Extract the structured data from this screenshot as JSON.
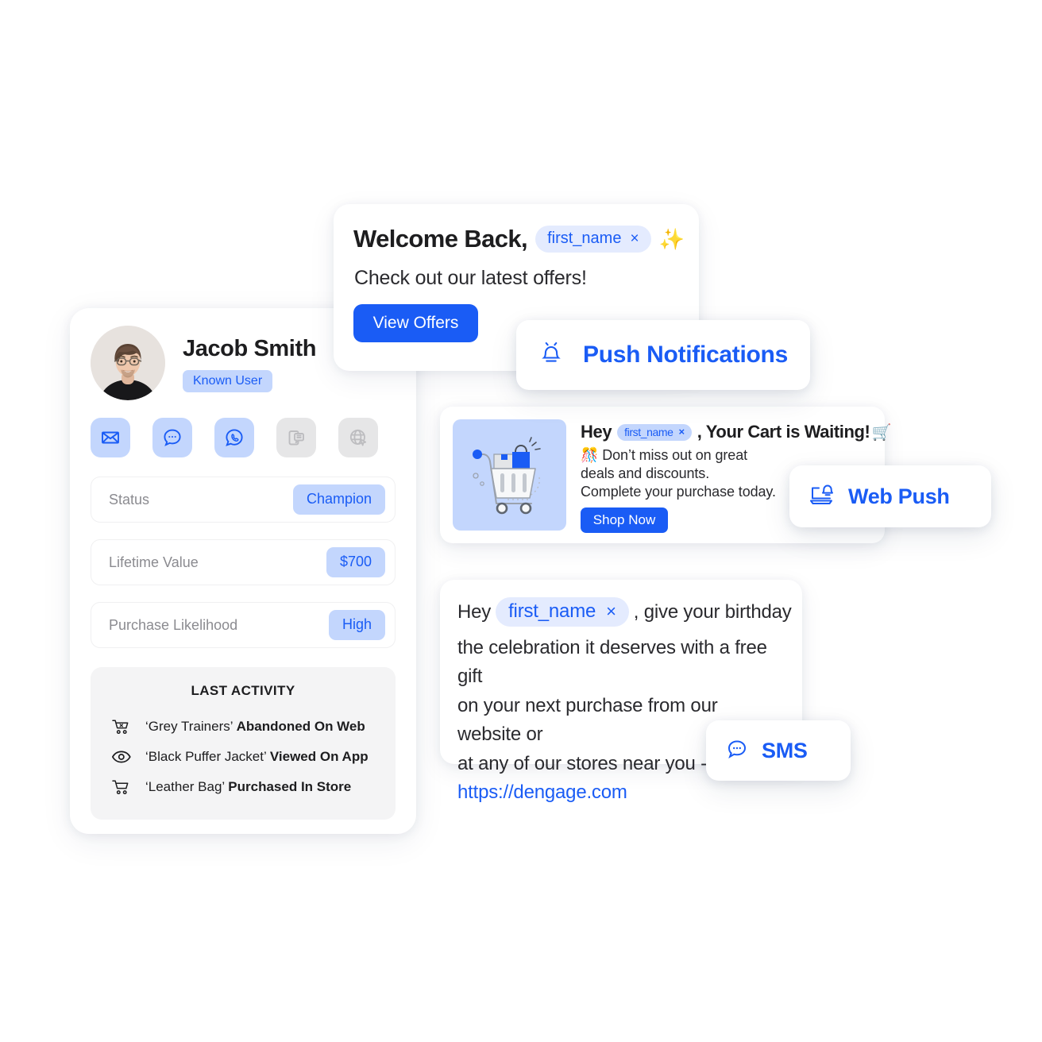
{
  "profile": {
    "name": "Jacob Smith",
    "badge": "Known User",
    "avatar_alt": "user-photo",
    "channels": [
      {
        "name": "email-icon",
        "label": "Email",
        "state": "on"
      },
      {
        "name": "sms-chat-icon",
        "label": "SMS",
        "state": "on"
      },
      {
        "name": "whatsapp-icon",
        "label": "WhatsApp",
        "state": "on"
      },
      {
        "name": "mobile-push-icon",
        "label": "Mobile Push",
        "state": "off"
      },
      {
        "name": "web-push-icon",
        "label": "Web Push",
        "state": "off"
      }
    ],
    "attributes": [
      {
        "label": "Status",
        "value": "Champion"
      },
      {
        "label": "Lifetime Value",
        "value": "$700"
      },
      {
        "label": "Purchase Likelihood",
        "value": "High"
      }
    ],
    "activity": {
      "title": "LAST ACTIVITY",
      "items": [
        {
          "icon": "cart-remove-icon",
          "product": "‘Grey Trainers’",
          "action": "Abandoned On Web"
        },
        {
          "icon": "eye-icon",
          "product": "‘Black Puffer Jacket’",
          "action": "Viewed On App"
        },
        {
          "icon": "cart-icon",
          "product": "‘Leather Bag’",
          "action": "Purchased In Store"
        }
      ]
    }
  },
  "welcome_card": {
    "title": "Welcome Back,",
    "token": "first_name",
    "token_remove": "×",
    "sparkle": "✨",
    "subtitle": "Check out our latest offers!",
    "button": "View Offers"
  },
  "cart_card": {
    "greeting": "Hey",
    "token": "first_name",
    "token_remove": "×",
    "headline_rest": ", Your Cart is Waiting!",
    "headline_emoji": "🛒",
    "body_emoji": "🎊",
    "body_line1": "Don’t miss out on great",
    "body_line2": "deals and discounts.",
    "body_line3": "Complete your purchase today.",
    "button": "Shop Now",
    "thumb_alt": "shopping-cart-illustration"
  },
  "sms_card": {
    "greeting": "Hey",
    "token": "first_name",
    "token_remove": "×",
    "line1_rest": ", give your birthday",
    "line2": "the celebration it deserves with a free gift",
    "line3": "on your next purchase from our website or",
    "line4": "at any of our stores near you -",
    "link": "https://dengage.com"
  },
  "badges": {
    "push": {
      "label": "Push Notifications",
      "icon": "bell-icon"
    },
    "web_push": {
      "label": "Web Push",
      "icon": "laptop-bell-icon"
    },
    "sms": {
      "label": "SMS",
      "icon": "chat-bubble-icon"
    }
  },
  "colors": {
    "accent_blue": "#1A5CF5",
    "chip_light": "#E4EBFE",
    "pill_blue": "#C3D6FD",
    "grey_off": "#E6E6E7",
    "text_dark": "#1D1D1F",
    "text_muted": "#8B8B90",
    "panel_grey": "#F4F4F5"
  }
}
